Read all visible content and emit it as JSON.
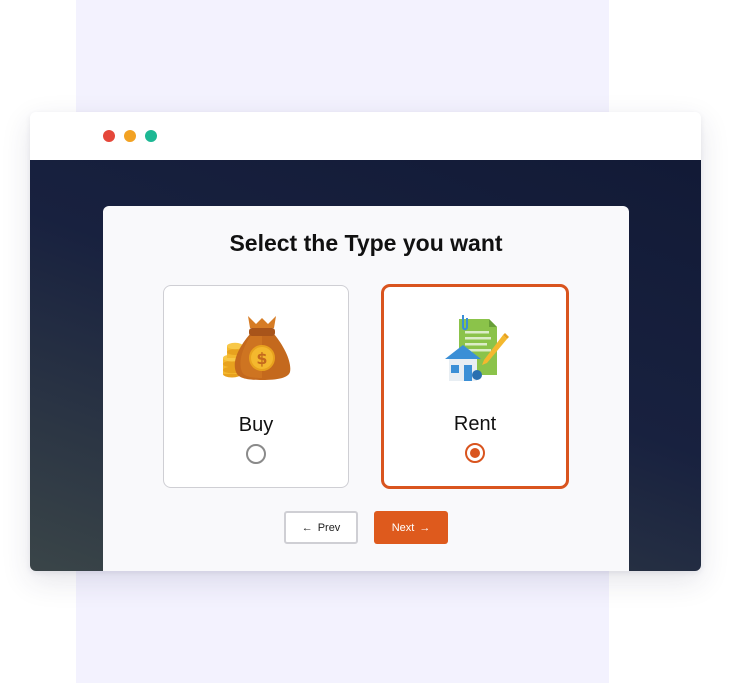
{
  "window": {
    "controls": [
      "close",
      "minimize",
      "maximize"
    ]
  },
  "wizard": {
    "title": "Select the Type you want",
    "options": [
      {
        "label": "Buy",
        "icon": "money-bag-icon",
        "selected": false
      },
      {
        "label": "Rent",
        "icon": "rental-contract-house-icon",
        "selected": true
      }
    ],
    "prev_label": "Prev",
    "prev_arrow": "←",
    "next_label": "Next",
    "next_arrow": "→"
  },
  "colors": {
    "accent": "#de5a1d",
    "background": "#f3f2fe",
    "dark": "#121a36"
  }
}
